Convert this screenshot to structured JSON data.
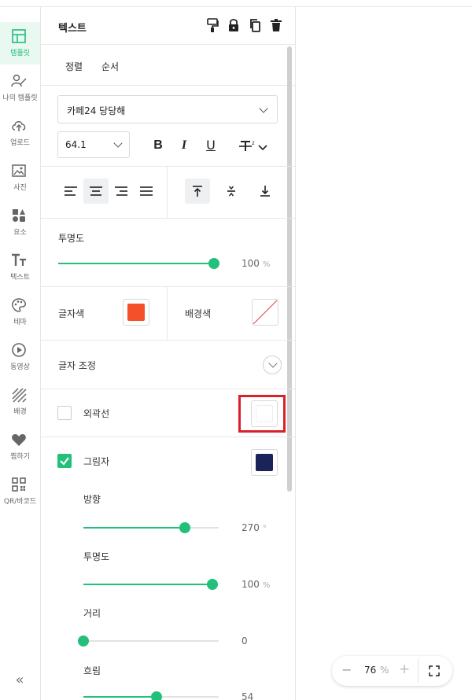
{
  "sidebar": {
    "items": [
      {
        "label": "템플릿",
        "icon": "template-icon",
        "active": true
      },
      {
        "label": "나의 템플릿",
        "icon": "my-template-icon"
      },
      {
        "label": "업로드",
        "icon": "upload-icon"
      },
      {
        "label": "사진",
        "icon": "photo-icon"
      },
      {
        "label": "요소",
        "icon": "elements-icon"
      },
      {
        "label": "텍스트",
        "icon": "text-icon"
      },
      {
        "label": "테마",
        "icon": "palette-icon"
      },
      {
        "label": "동영상",
        "icon": "video-icon"
      },
      {
        "label": "배경",
        "icon": "background-icon"
      },
      {
        "label": "찜하기",
        "icon": "heart-icon"
      },
      {
        "label": "QR/바코드",
        "icon": "qr-icon"
      }
    ],
    "collapse_label": "«",
    "accent": "#1fbf7c"
  },
  "panel": {
    "title": "텍스트",
    "header_icons": [
      "paint-format-icon",
      "lock-icon",
      "copy-icon",
      "trash-icon"
    ],
    "tabs": [
      {
        "label": "정렬"
      },
      {
        "label": "순서"
      }
    ],
    "font_family": "카페24 당당해",
    "font_size": "64.1",
    "format_buttons": {
      "bold": "B",
      "italic": "I",
      "underline": "U"
    },
    "opacity": {
      "label": "투명도",
      "value": "100",
      "unit": "%",
      "fraction": 1.0
    },
    "text_color": {
      "label": "글자색",
      "color": "#f4502a"
    },
    "bg_color": {
      "label": "배경색",
      "color": "none"
    },
    "text_adjust": {
      "label": "글자 조정"
    },
    "outline": {
      "label": "외곽선",
      "checked": false,
      "color": "#ffffff"
    },
    "shadow": {
      "label": "그림자",
      "checked": true,
      "color": "#1b2459",
      "direction": {
        "label": "방향",
        "value": "270",
        "unit": "°",
        "fraction": 0.75
      },
      "opacity": {
        "label": "투명도",
        "value": "100",
        "unit": "%",
        "fraction": 1.0
      },
      "distance": {
        "label": "거리",
        "value": "0",
        "unit": "",
        "fraction": 0.0
      },
      "blur": {
        "label": "흐림",
        "value": "54",
        "unit": "",
        "fraction": 0.54
      }
    }
  },
  "zoom": {
    "minus": "−",
    "value": "76",
    "unit": "%",
    "plus": "+"
  }
}
